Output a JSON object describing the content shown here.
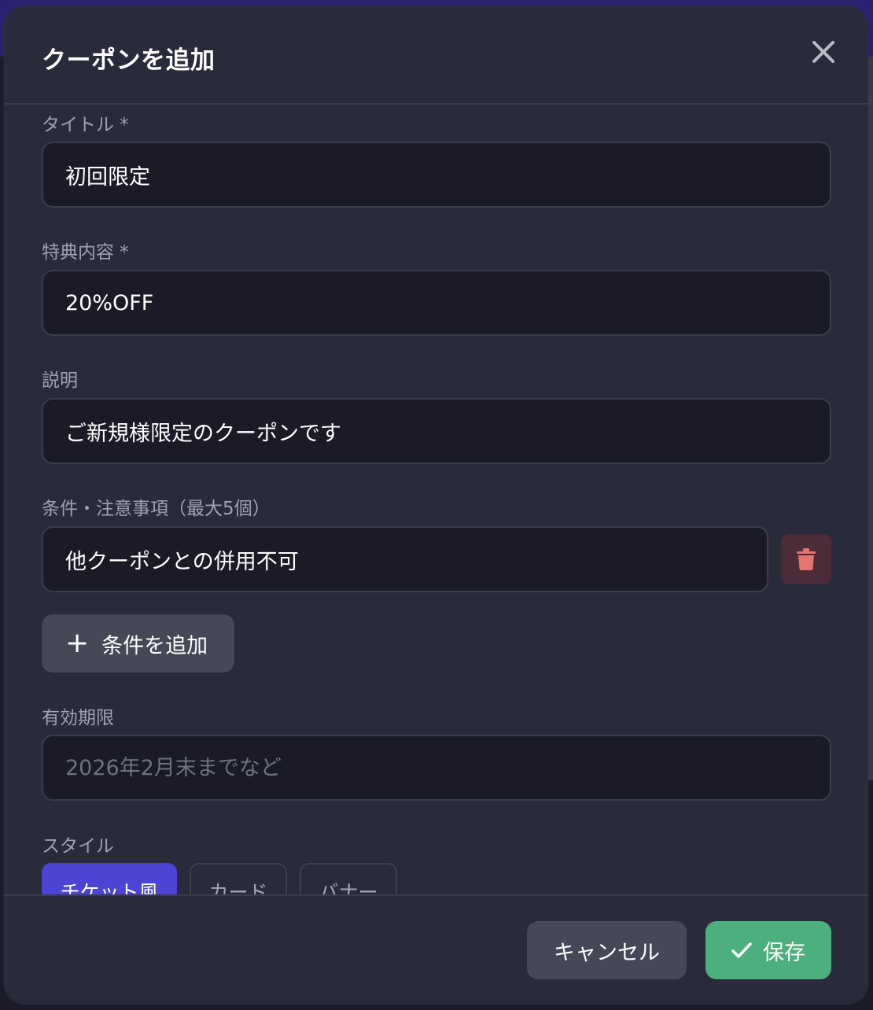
{
  "dialog": {
    "title": "クーポンを追加",
    "close_icon": "close-icon"
  },
  "form": {
    "title_label": "タイトル *",
    "title_value": "初回限定",
    "benefit_label": "特典内容 *",
    "benefit_value": "20%OFF",
    "description_label": "説明",
    "description_value": "ご新規様限定のクーポンです",
    "conditions_label": "条件・注意事項（最大5個）",
    "conditions": [
      {
        "value": "他クーポンとの併用不可"
      }
    ],
    "add_condition_label": "条件を追加",
    "expiry_label": "有効期限",
    "expiry_value": "",
    "expiry_placeholder": "2026年2月末までなど",
    "style_label": "スタイル",
    "style_options": [
      {
        "label": "チケット風",
        "selected": true
      },
      {
        "label": "カード",
        "selected": false
      },
      {
        "label": "バナー",
        "selected": false
      }
    ]
  },
  "footer": {
    "cancel_label": "キャンセル",
    "save_label": "保存"
  },
  "colors": {
    "accent": "#4b44d4",
    "save": "#4caf7d",
    "danger": "#e5736f"
  }
}
